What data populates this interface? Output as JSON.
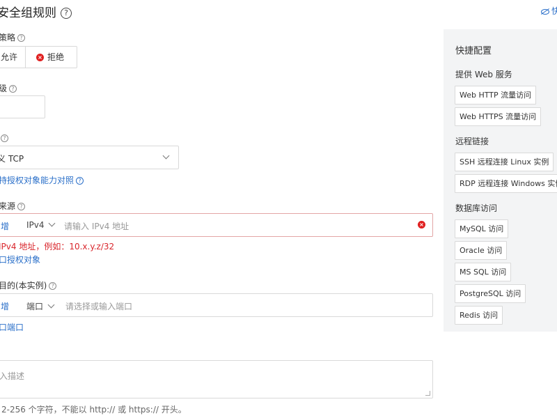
{
  "page": {
    "title": "安全组规则",
    "top_link": "快"
  },
  "policy": {
    "label": "策略",
    "allow_label": "允许",
    "deny_label": "拒绝"
  },
  "priority": {
    "label": "级",
    "value": ""
  },
  "protocol": {
    "label": "",
    "value": "义 TCP",
    "link": "持授权对象能力对照"
  },
  "source": {
    "label": "来源",
    "add_label": "增",
    "type": "IPv4",
    "placeholder": "请输入 IPv4 地址",
    "error": "IPv4 地址，例如：10.x.y.z/32",
    "add_link": "口授权对象"
  },
  "destination": {
    "label": "目的(本实例)",
    "add_label": "增",
    "type": "端口",
    "placeholder": "请选择或输入端口",
    "add_link": "口端口"
  },
  "description": {
    "placeholder": "入描述",
    "hint": "2-256 个字符，不能以 http:// 或 https:// 开头。"
  },
  "quick_config": {
    "title": "快捷配置",
    "groups": [
      {
        "label": "提供 Web 服务",
        "items": [
          "Web HTTP 流量访问",
          "Web HTTPS 流量访问"
        ]
      },
      {
        "label": "远程链接",
        "items": [
          "SSH 远程连接 Linux 实例",
          "RDP 远程连接 Windows 实例"
        ]
      },
      {
        "label": "数据库访问",
        "items": [
          "MySQL 访问",
          "Oracle 访问",
          "MS SQL 访问",
          "PostgreSQL 访问",
          "Redis 访问"
        ]
      }
    ]
  },
  "colors": {
    "link": "#2a6fc9",
    "error": "#d9262c",
    "panel_bg": "#f3f4f5"
  }
}
